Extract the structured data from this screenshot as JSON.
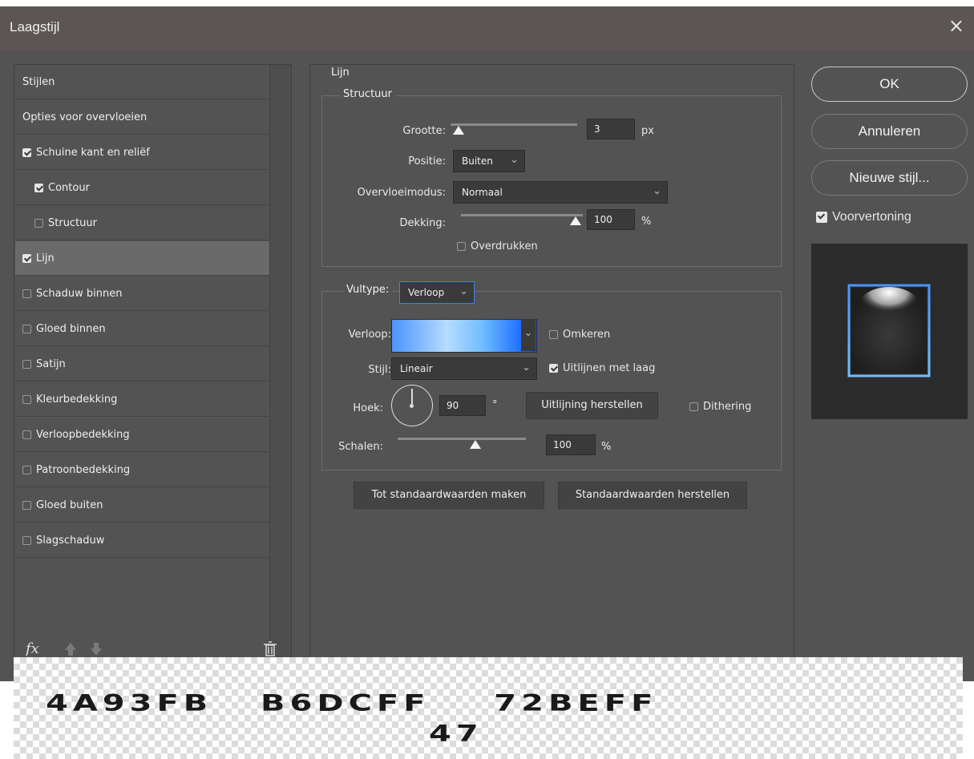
{
  "titlebar": {
    "title": "Laagstijl",
    "close": "×"
  },
  "left_panel": {
    "items": [
      {
        "label": "Stijlen",
        "checkbox": null,
        "selected": false,
        "plus": false
      },
      {
        "label": "Opties voor overvloeien",
        "checkbox": null,
        "selected": false,
        "plus": false
      },
      {
        "label": "Schuine kant en reliëf",
        "checkbox": true,
        "selected": false,
        "plus": false
      },
      {
        "label": "Contour",
        "checkbox": true,
        "selected": false,
        "plus": false,
        "indent": true
      },
      {
        "label": "Structuur",
        "checkbox": false,
        "selected": false,
        "plus": false,
        "indent": true
      },
      {
        "label": "Lijn",
        "checkbox": true,
        "selected": true,
        "plus": true
      },
      {
        "label": "Schaduw binnen",
        "checkbox": false,
        "selected": false,
        "plus": true
      },
      {
        "label": "Gloed binnen",
        "checkbox": false,
        "selected": false,
        "plus": false
      },
      {
        "label": "Satijn",
        "checkbox": false,
        "selected": false,
        "plus": false
      },
      {
        "label": "Kleurbedekking",
        "checkbox": false,
        "selected": false,
        "plus": true
      },
      {
        "label": "Verloopbedekking",
        "checkbox": false,
        "selected": false,
        "plus": true
      },
      {
        "label": "Patroonbedekking",
        "checkbox": false,
        "selected": false,
        "plus": false
      },
      {
        "label": "Gloed buiten",
        "checkbox": false,
        "selected": false,
        "plus": false
      },
      {
        "label": "Slagschaduw",
        "checkbox": false,
        "selected": false,
        "plus": true
      }
    ],
    "fx_label": "fx"
  },
  "lijn": {
    "legend": "Lijn",
    "structuur": {
      "legend": "Structuur",
      "grootte_label": "Grootte:",
      "grootte_value": "3",
      "grootte_unit": "px",
      "grootte_fraction": 0.02,
      "positie_label": "Positie:",
      "positie_value": "Buiten",
      "overvloeimodus_label": "Overvloeimodus:",
      "overvloeimodus_value": "Normaal",
      "dekking_label": "Dekking:",
      "dekking_value": "100",
      "dekking_unit": "%",
      "overdrukken_label": "Overdrukken",
      "overdrukken_checked": false
    },
    "vultype": {
      "label": "Vultype:",
      "value": "Verloop",
      "verloop_label": "Verloop:",
      "gradient_colors": [
        "#4A93FB",
        "#B6DCFF",
        "#72BEFF",
        "#0050FF"
      ],
      "omkeren_label": "Omkeren",
      "omkeren_checked": false,
      "stijl_label": "Stijl:",
      "stijl_value": "Lineair",
      "uitlijnen_label": "Uitlijnen met laag",
      "uitlijnen_checked": true,
      "hoek_label": "Hoek:",
      "hoek_value": "90",
      "hoek_unit": "°",
      "uitlijning_button": "Uitlijning herstellen",
      "dithering_label": "Dithering",
      "dithering_checked": false,
      "schalen_label": "Schalen:",
      "schalen_value": "100",
      "schalen_unit": "%"
    },
    "buttons": {
      "make_default": "Tot standaardwaarden maken",
      "reset_default": "Standaardwaarden herstellen"
    }
  },
  "right_panel": {
    "ok": "OK",
    "annuleren": "Annuleren",
    "nieuwe_stijl": "Nieuwe stijl...",
    "voorvertoning_label": "Voorvertoning",
    "voorvertoning_checked": true
  },
  "overlay": {
    "line1": [
      "4A93FB",
      "B6DCFF",
      "72BEFF"
    ],
    "line2": "47"
  },
  "colors": {
    "accent": "#3a82f6",
    "dialog_bg": "#535353"
  }
}
